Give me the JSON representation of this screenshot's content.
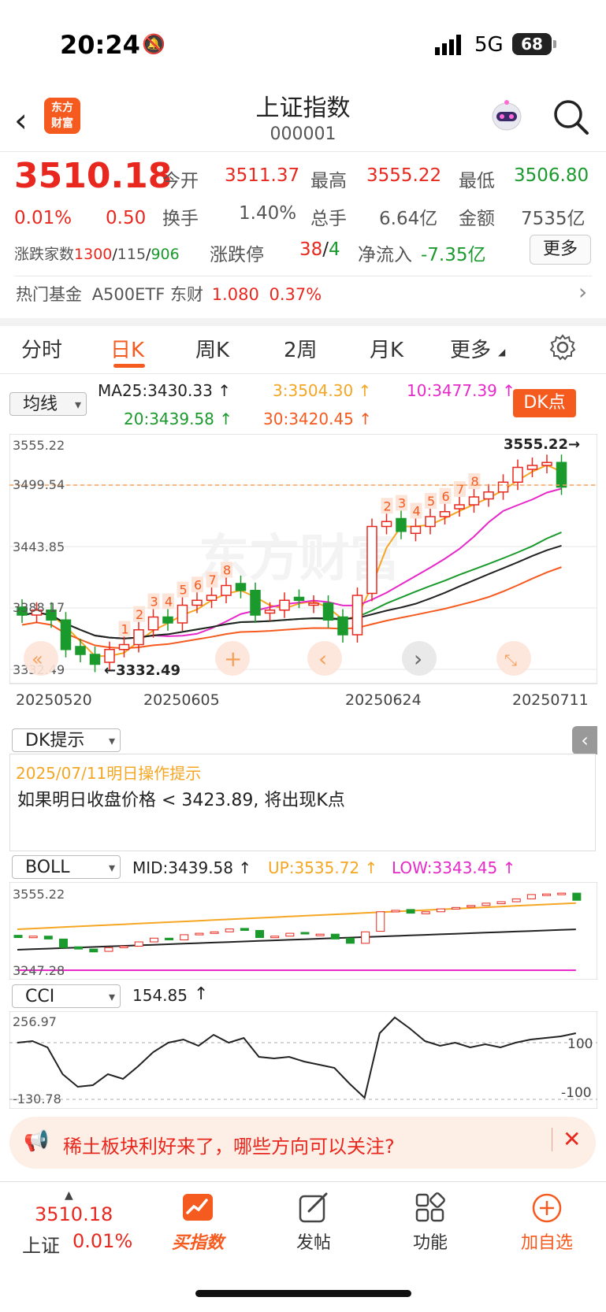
{
  "status": {
    "time": "20:24",
    "network": "5G",
    "battery": "68"
  },
  "header": {
    "title": "上证指数",
    "code": "000001",
    "logo_line1": "东方",
    "logo_line2": "财富"
  },
  "quote": {
    "price": "3510.18",
    "change_pct": "0.01%",
    "change_amt": "0.50",
    "open_label": "今开",
    "open": "3511.37",
    "high_label": "最高",
    "high": "3555.22",
    "low_label": "最低",
    "low": "3506.80",
    "turnover_label": "换手",
    "turnover": "1.40%",
    "volume_label": "总手",
    "volume": "6.64亿",
    "amount_label": "金额",
    "amount": "7535亿",
    "breadth_label": "涨跌家数",
    "up_count": "1300",
    "flat_count": "115",
    "down_count": "906",
    "limit_label": "涨跌停",
    "limit_up": "38",
    "limit_down": "4",
    "netflow_label": "净流入",
    "netflow": "-7.35亿",
    "more_label": "更多"
  },
  "fund": {
    "label": "热门基金",
    "name": "A500ETF 东财",
    "price": "1.080",
    "pct": "0.37%"
  },
  "tabs": [
    "分时",
    "日K",
    "周K",
    "2周",
    "月K",
    "更多"
  ],
  "ma": {
    "selector": "均线",
    "ma25": "MA25:3430.33",
    "ma3": "3:3504.30",
    "ma10": "10:3477.39",
    "ma20": "20:3439.58",
    "ma30": "30:3420.45",
    "dk_button": "DK点"
  },
  "kchart": {
    "y_labels": [
      "3555.22",
      "3499.54",
      "3443.85",
      "3388.17",
      "3332.49"
    ],
    "high_marker": "3555.22→",
    "low_marker": "←3332.49",
    "dates": [
      "20250520",
      "20250605",
      "20250624",
      "20250711"
    ],
    "watermark": "东方财富"
  },
  "dk_tip": {
    "selector": "DK提示",
    "date": "2025/07/11明日操作提示",
    "text": "如果明日收盘价格 < 3423.89, 将出现K点"
  },
  "boll": {
    "selector": "BOLL",
    "mid": "MID:3439.58",
    "up": "UP:3535.72",
    "low": "LOW:3343.45",
    "y_top": "3555.22",
    "y_bottom": "3247.28"
  },
  "cci": {
    "selector": "CCI",
    "value": "154.85",
    "y_top": "256.97",
    "y_bottom": "-130.78",
    "level_hi": "100",
    "level_lo": "-100"
  },
  "announcement": {
    "text": "稀土板块利好来了，哪些方向可以关注?"
  },
  "bottom_nav": {
    "index_price": "3510.18",
    "index_name": "上证",
    "index_pct": "0.01%",
    "items": [
      "买指数",
      "发帖",
      "功能",
      "加自选"
    ]
  },
  "colors": {
    "up": "#e8281e",
    "down": "#1a9a2c",
    "accent": "#f55a1e"
  }
}
